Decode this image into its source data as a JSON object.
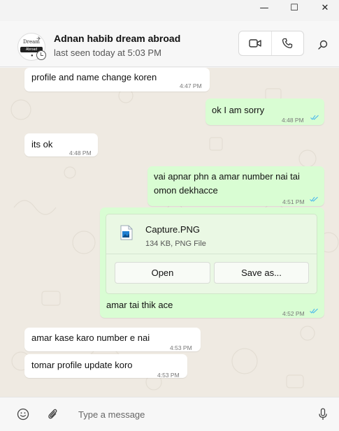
{
  "window": {
    "minimize_glyph": "—",
    "maximize_glyph": "☐",
    "close_glyph": "✕"
  },
  "contact": {
    "name": "Adnan habib dream abroad",
    "status": "last seen today at 5:03 PM",
    "avatar_text": "Dream",
    "avatar_band_text": "Abroad"
  },
  "header_actions": {
    "video_icon": "video-call-icon",
    "voice_icon": "phone-icon",
    "search_icon": "search-icon"
  },
  "messages": [
    {
      "direction": "in",
      "text": "profile and name change koren",
      "time": "4:47 PM"
    },
    {
      "direction": "out",
      "text": "ok I am sorry",
      "time": "4:48 PM",
      "read": true
    },
    {
      "direction": "in",
      "text": "its ok",
      "time": "4:48 PM"
    },
    {
      "direction": "out",
      "text": [
        "vai apnar phn a amar number nai tai",
        "omon dekhacce"
      ],
      "time": "4:51 PM",
      "read": true
    },
    {
      "direction": "out",
      "type": "file",
      "file_name": "Capture.PNG",
      "file_meta": "134 KB, PNG File",
      "open_label": "Open",
      "save_label": "Save as...",
      "caption": "amar tai thik ace",
      "time": "4:52 PM",
      "read": true
    },
    {
      "direction": "in",
      "text": "amar kase karo number e nai",
      "time": "4:53 PM"
    },
    {
      "direction": "in",
      "text": "tomar profile update koro",
      "time": "4:53 PM"
    }
  ],
  "composer": {
    "placeholder": "Type a message",
    "emoji_icon": "emoji-icon",
    "attach_icon": "paperclip-icon",
    "mic_icon": "microphone-icon"
  },
  "colors": {
    "incoming": "#ffffff",
    "outgoing": "#d9fdd3",
    "read_tick": "#53bdeb",
    "chat_bg": "#efeae2"
  }
}
